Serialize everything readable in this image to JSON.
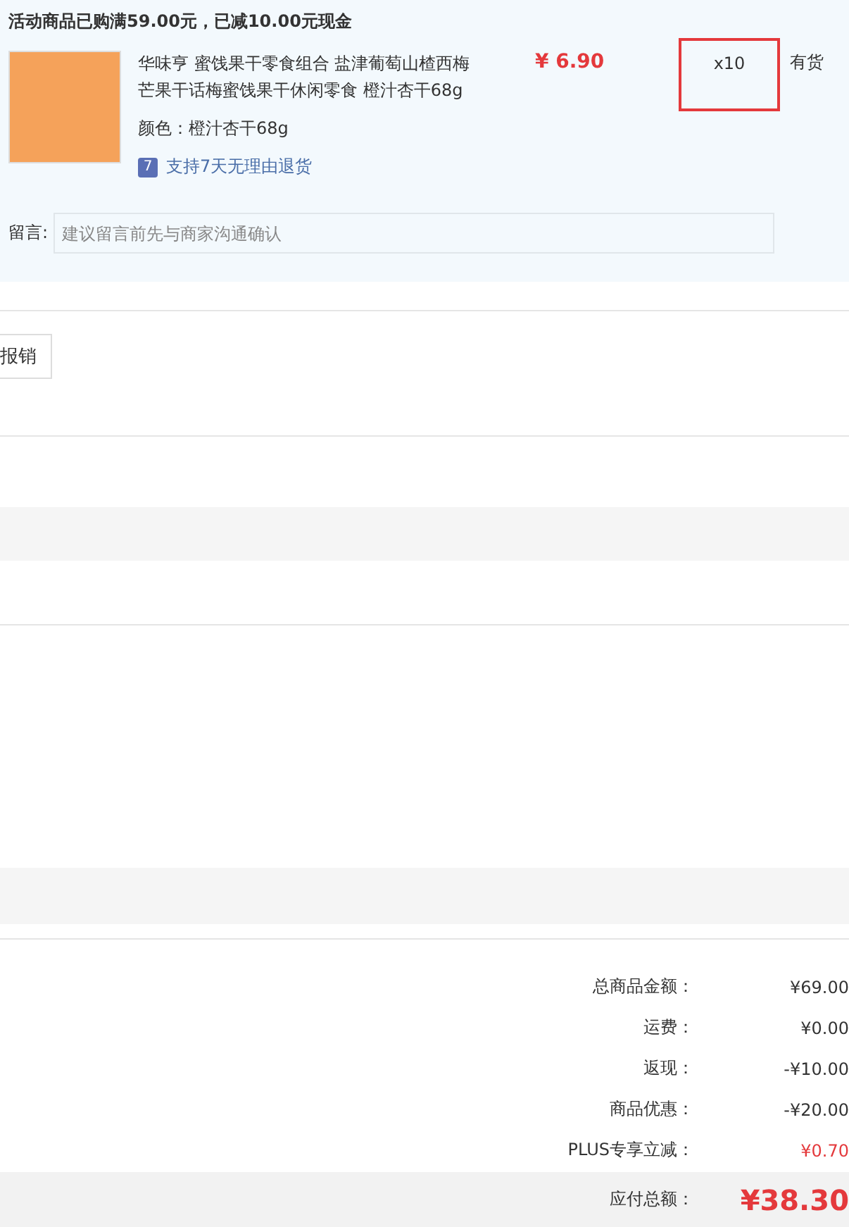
{
  "promo_notice": "活动商品已购满59.00元，已减10.00元现金",
  "product": {
    "title": "华味亨 蜜饯果干零食组合 盐津葡萄山楂西梅芒果干话梅蜜饯果干休闲零食 橙汁杏干68g",
    "color_label": "颜色：",
    "color_value": "橙汁杏干68g",
    "return_badge": "7",
    "return_policy": "支持7天无理由退货",
    "price": "¥ 6.90",
    "quantity": "x10",
    "quantity_highlighted": true,
    "stock": "有货"
  },
  "note": {
    "label": "留言:",
    "placeholder": "建议留言前先与商家沟通确认"
  },
  "reimburse_button": "报销",
  "totals": [
    {
      "kind": "normal",
      "label": "总商品金额：",
      "value": "¥69.00"
    },
    {
      "kind": "normal",
      "label": "运费：",
      "value": "¥0.00"
    },
    {
      "kind": "normal",
      "label": "返现：",
      "value": "-¥10.00"
    },
    {
      "kind": "normal",
      "label": "商品优惠：",
      "value": "-¥20.00"
    },
    {
      "kind": "plus",
      "label": "PLUS专享立减：",
      "value": "¥0.70"
    }
  ],
  "payable": {
    "label": "应付总额：",
    "value": "¥38.30"
  }
}
